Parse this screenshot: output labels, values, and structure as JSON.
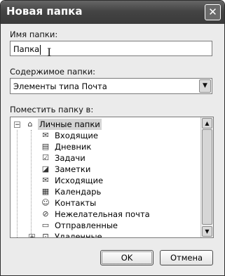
{
  "dialog": {
    "title": "Новая папка",
    "close_label": "✕"
  },
  "name_field": {
    "label": "Имя папки:",
    "value": "Папка"
  },
  "contents_field": {
    "label": "Содержимое папки:",
    "value": "Элементы типа Почта"
  },
  "location_field": {
    "label": "Поместить папку в:"
  },
  "tree": {
    "root": {
      "label": "Личные папки",
      "icon": "personal-folders-icon",
      "expander": "−"
    },
    "items": [
      {
        "label": "Входящие",
        "icon": "inbox-icon",
        "glyph": "✉"
      },
      {
        "label": "Дневник",
        "icon": "journal-icon",
        "glyph": "▤"
      },
      {
        "label": "Задачи",
        "icon": "tasks-icon",
        "glyph": "☑"
      },
      {
        "label": "Заметки",
        "icon": "notes-icon",
        "glyph": "◪"
      },
      {
        "label": "Исходящие",
        "icon": "outbox-icon",
        "glyph": "✉"
      },
      {
        "label": "Календарь",
        "icon": "calendar-icon",
        "glyph": "▦"
      },
      {
        "label": "Контакты",
        "icon": "contacts-icon",
        "glyph": "☺"
      },
      {
        "label": "Нежелательная почта",
        "icon": "junk-mail-icon",
        "glyph": "⊘"
      },
      {
        "label": "Отправленные",
        "icon": "sent-items-icon",
        "glyph": "▭"
      },
      {
        "label": "Удаленные",
        "icon": "deleted-items-icon",
        "glyph": "⊡",
        "expander": "+"
      }
    ]
  },
  "buttons": {
    "ok": "OK",
    "cancel": "Отмена"
  },
  "glyphs": {
    "dropdown": "▼",
    "scroll_up": "▲",
    "scroll_down": "▼",
    "cursor": "I"
  }
}
